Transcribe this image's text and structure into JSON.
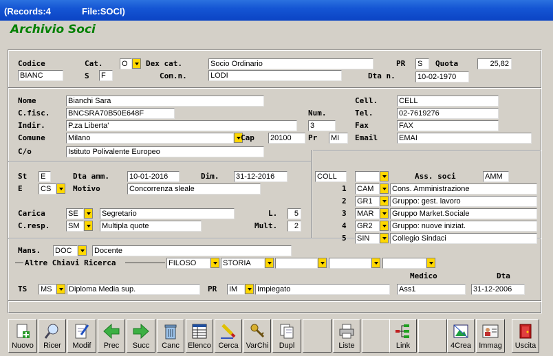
{
  "window": {
    "records": "(Records:4",
    "file": "File:SOCI)"
  },
  "form_title": "Archivio Soci",
  "labels": {
    "codice": "Codice",
    "cat": "Cat.",
    "dexcat": "Dex cat.",
    "pr": "PR",
    "quota": "Quota",
    "s": "S",
    "comn": "Com.n.",
    "dtan": "Dta n.",
    "nome": "Nome",
    "cfisc": "C.fisc.",
    "indir": "Indir.",
    "comune": "Comune",
    "co": "C/o",
    "cell": "Cell.",
    "num": "Num.",
    "tel": "Tel.",
    "fax": "Fax",
    "cap": "Cap",
    "pr2": "Pr",
    "email": "Email",
    "st": "St",
    "dtaamm": "Dta amm.",
    "dim": "Dim.",
    "e": "E",
    "motivo": "Motivo",
    "carica": "Carica",
    "cresp": "C.resp.",
    "l": "L.",
    "mult": "Mult.",
    "asssoci": "Ass. soci",
    "n1": "1",
    "n2": "2",
    "n3": "3",
    "n4": "4",
    "n5": "5",
    "mans": "Mans.",
    "altre": "Altre Chiavi Ricerca",
    "medico": "Medico",
    "dta": "Dta",
    "ts": "TS",
    "pr3": "PR"
  },
  "fields": {
    "codice": "BIANC",
    "cat": "O",
    "dexcat": "Socio Ordinario",
    "pr": "S",
    "quota": "25,82",
    "s": "F",
    "comn": "LODI",
    "dtan": "10-02-1970",
    "nome": "Bianchi Sara",
    "cfisc": "BNCSRA70B50E648F",
    "indir": "P.za Liberta'",
    "num": "3",
    "comune": "Milano",
    "cap": "20100",
    "pr2": "MI",
    "co": "Istituto Polivalente Europeo",
    "cell": "CELL",
    "tel": "02-7619276",
    "fax": "FAX",
    "email": "EMAI",
    "st": "E",
    "dtaamm": "10-01-2016",
    "dim": "31-12-2016",
    "e": "CS",
    "motivo": "Concorrenza sleale",
    "carica": "SE",
    "carica_desc": "Segretario",
    "l": "5",
    "cresp": "SM",
    "cresp_desc": "Multipla quote",
    "mult": "2",
    "coll": "COLL",
    "coll_sel": "",
    "amm": "AMM",
    "mans": "DOC",
    "mans_desc": "Docente",
    "key1": "FILOSO",
    "key2": "STORIA",
    "key3": "",
    "key4": "",
    "key5": "",
    "ts": "MS",
    "ts_desc": "Diploma Media sup.",
    "pr3": "IM",
    "pr3_desc": "Impiegato",
    "medico": "Ass1",
    "dta": "31-12-2006"
  },
  "assoc": [
    {
      "code": "CAM",
      "desc": "Cons. Amministrazione"
    },
    {
      "code": "GR1",
      "desc": "Gruppo: gest. lavoro"
    },
    {
      "code": "MAR",
      "desc": "Gruppo Market.Sociale"
    },
    {
      "code": "GR2",
      "desc": "Gruppo: nuove iniziat."
    },
    {
      "code": "SIN",
      "desc": "Collegio Sindaci"
    }
  ],
  "toolbar": {
    "nuovo": "Nuovo",
    "ricer": "Ricer",
    "modif": "Modif",
    "prec": "Prec",
    "succ": "Succ",
    "canc": "Canc",
    "elenco": "Elenco",
    "cerca": "Cerca",
    "varchi": "VarChi",
    "dupl": "Dupl",
    "liste": "Liste",
    "link": "Link",
    "crea": "4Crea",
    "immag": "Immag",
    "uscita": "Uscita"
  },
  "colors": {
    "title_green": "#008000",
    "dropdown": "#ffd700",
    "titlebar": "#0b44c4"
  }
}
